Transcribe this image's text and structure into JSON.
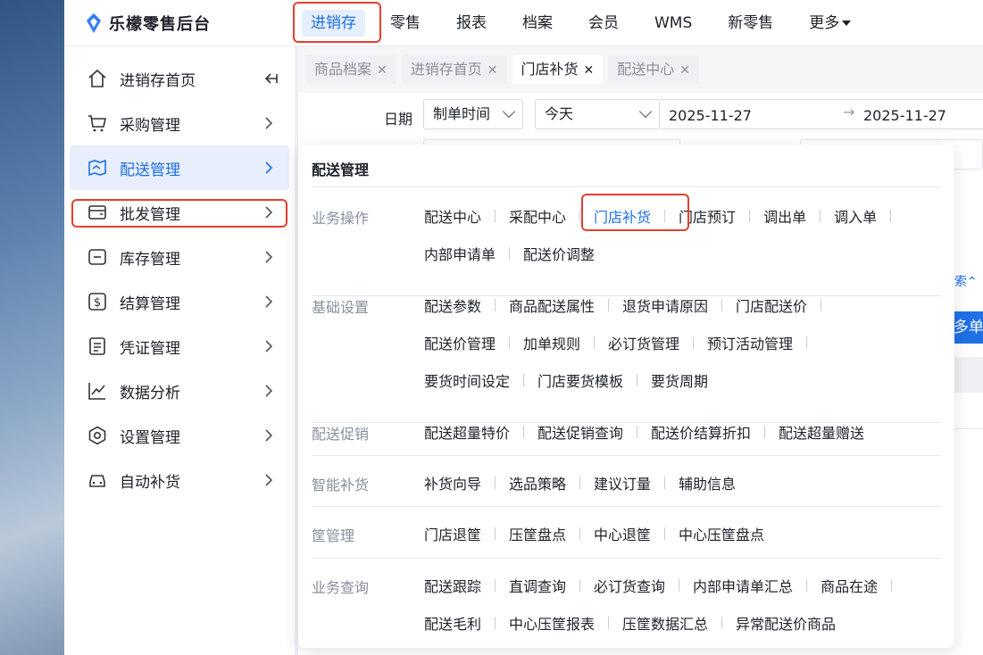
{
  "brand": {
    "name": "乐檬零售后台"
  },
  "topnav": [
    {
      "label": "进销存",
      "active": true
    },
    {
      "label": "零售"
    },
    {
      "label": "报表"
    },
    {
      "label": "档案"
    },
    {
      "label": "会员"
    },
    {
      "label": "WMS"
    },
    {
      "label": "新零售"
    },
    {
      "label": "更多"
    }
  ],
  "sidebar": {
    "items": [
      {
        "label": "进销存首页",
        "icon": "home-icon"
      },
      {
        "label": "采购管理",
        "icon": "cart-icon"
      },
      {
        "label": "配送管理",
        "icon": "map-icon",
        "active": true
      },
      {
        "label": "批发管理",
        "icon": "wallet-icon"
      },
      {
        "label": "库存管理",
        "icon": "box-icon"
      },
      {
        "label": "结算管理",
        "icon": "dollar-icon"
      },
      {
        "label": "凭证管理",
        "icon": "document-icon"
      },
      {
        "label": "数据分析",
        "icon": "line-chart-icon"
      },
      {
        "label": "设置管理",
        "icon": "settings-icon"
      },
      {
        "label": "自动补货",
        "icon": "car-icon"
      }
    ]
  },
  "tabs": [
    {
      "label": "商品档案"
    },
    {
      "label": "进销存首页"
    },
    {
      "label": "门店补货",
      "active": true
    },
    {
      "label": "配送中心"
    }
  ],
  "filter": {
    "date_label": "日期",
    "date_type": "制单时间",
    "range": "今天",
    "start": "2025-11-27",
    "arrow": "→",
    "end": "2025-11-27",
    "peek_link": "索⌃",
    "peek_button": "多单合"
  },
  "panel": {
    "title": "配送管理",
    "sections": [
      {
        "label": "业务操作",
        "rows": [
          [
            "配送中心",
            "采配中心",
            "门店补货",
            "门店预订",
            "调出单",
            "调入单"
          ],
          [
            "内部申请单",
            "配送价调整"
          ]
        ]
      },
      {
        "label": "基础设置",
        "rows": [
          [
            "配送参数",
            "商品配送属性",
            "退货申请原因",
            "门店配送价"
          ],
          [
            "配送价管理",
            "加单规则",
            "必订货管理",
            "预订活动管理"
          ],
          [
            "要货时间设定",
            "门店要货模板",
            "要货周期"
          ]
        ]
      },
      {
        "label": "配送促销",
        "rows": [
          [
            "配送超量特价",
            "配送促销查询",
            "配送价结算折扣",
            "配送超量赠送"
          ]
        ]
      },
      {
        "label": "智能补货",
        "rows": [
          [
            "补货向导",
            "选品策略",
            "建议订量",
            "辅助信息"
          ]
        ]
      },
      {
        "label": "筐管理",
        "rows": [
          [
            "门店退筐",
            "压筐盘点",
            "中心退筐",
            "中心压筐盘点"
          ]
        ]
      },
      {
        "label": "业务查询",
        "rows": [
          [
            "配送跟踪",
            "直调查询",
            "必订货查询",
            "内部申请单汇总",
            "商品在途"
          ],
          [
            "配送毛利",
            "中心压筐报表",
            "压筐数据汇总",
            "异常配送价商品"
          ]
        ]
      }
    ]
  },
  "colors": {
    "accent": "#1f6fe5",
    "highlight": "#e2402f"
  }
}
